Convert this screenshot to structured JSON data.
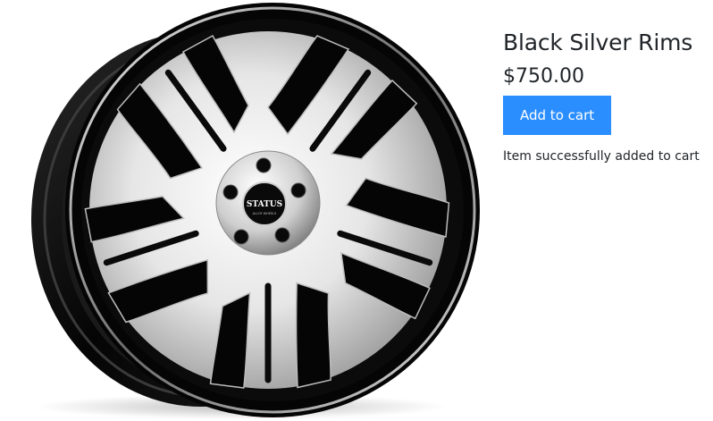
{
  "product": {
    "title": "Black Silver Rims",
    "price": "$750.00",
    "image_alt": "Black and silver machined alloy wheel",
    "brand_logo_text": "STATUS",
    "brand_logo_subtext": "ALLOY WHEELS"
  },
  "cart": {
    "add_button_label": "Add to cart",
    "status_message": "Item successfully added to cart"
  },
  "colors": {
    "accent": "#2b8eff",
    "text": "#212529",
    "wheel_black": "#0a0a0a",
    "wheel_silver": "#d9d9d9"
  }
}
